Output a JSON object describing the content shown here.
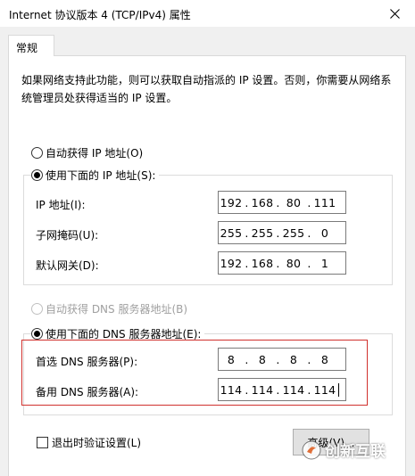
{
  "window": {
    "title": "Internet 协议版本 4 (TCP/IPv4) 属性"
  },
  "tabs": [
    {
      "label": "常规"
    }
  ],
  "description": "如果网络支持此功能，则可以获取自动指派的 IP 设置。否则，你需要从网络系统管理员处获得适当的 IP 设置。",
  "ip_section": {
    "auto_label": "自动获得 IP 地址(O)",
    "manual_label": "使用下面的 IP 地址(S):",
    "selected": "manual",
    "fields": [
      {
        "label": "IP 地址(I):",
        "value": [
          "192",
          "168",
          "80",
          "111"
        ]
      },
      {
        "label": "子网掩码(U):",
        "value": [
          "255",
          "255",
          "255",
          "0"
        ]
      },
      {
        "label": "默认网关(D):",
        "value": [
          "192",
          "168",
          "80",
          "1"
        ]
      }
    ]
  },
  "dns_section": {
    "auto_label": "自动获得 DNS 服务器地址(B)",
    "manual_label": "使用下面的 DNS 服务器地址(E):",
    "selected": "manual",
    "fields": [
      {
        "label": "首选 DNS 服务器(P):",
        "value": [
          "8",
          "8",
          "8",
          "8"
        ]
      },
      {
        "label": "备用 DNS 服务器(A):",
        "value": [
          "114",
          "114",
          "114",
          "114"
        ]
      }
    ]
  },
  "validate_checkbox": {
    "label": "退出时验证设置(L)",
    "checked": false
  },
  "advanced_button": {
    "label": "高级(V)..."
  },
  "watermark": {
    "text": "创新互联"
  },
  "colors": {
    "highlight_border": "#d0312d",
    "panel_bg": "#ffffff",
    "window_bg": "#f0f0f0"
  }
}
